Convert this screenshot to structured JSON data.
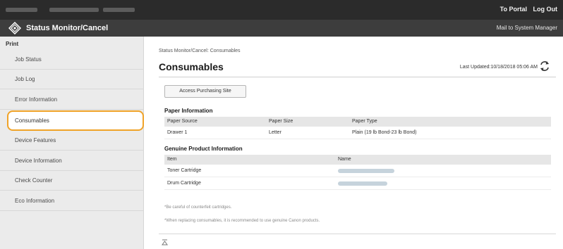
{
  "header": {
    "top_links": [
      "To Portal",
      "Log Out"
    ],
    "app_title": "Status Monitor/Cancel",
    "mail_link": "Mail to System Manager"
  },
  "sidebar": {
    "section": "Print",
    "items": [
      {
        "label": "Job Status"
      },
      {
        "label": "Job Log"
      },
      {
        "label": "Error Information"
      },
      {
        "label": "Consumables"
      },
      {
        "label": "Device Features"
      },
      {
        "label": "Device Information"
      },
      {
        "label": "Check Counter"
      },
      {
        "label": "Eco Information"
      }
    ],
    "active": "Consumables"
  },
  "main": {
    "breadcrumb": "Status Monitor/Cancel: Consumables",
    "title": "Consumables",
    "last_updated": "Last Updated:10/18/2018 05:06 AM",
    "access_button": "Access Purchasing Site",
    "paper": {
      "heading": "Paper Information",
      "columns": [
        "Paper Source",
        "Paper Size",
        "Paper Type"
      ],
      "rows": [
        [
          "Drawer 1",
          "Letter",
          "Plain (19 lb Bond-23 lb Bond)"
        ]
      ]
    },
    "genuine": {
      "heading": "Genuine Product Information",
      "columns": [
        "Item",
        "Name"
      ],
      "rows": [
        [
          "Toner Cartridge"
        ],
        [
          "Drum Cartridge"
        ]
      ]
    },
    "notes": [
      "*Be careful of counterfeit cartridges.",
      "*When replacing consumables, it is recommended to use genuine Canon products."
    ]
  },
  "colors": {
    "topbar": "#2b2b2b",
    "titlebar": "#3d3d3d",
    "sidebar": "#ebebeb",
    "active_highlight": "#f0a328"
  },
  "icons": {
    "logo": "canon-emblem-icon",
    "refresh": "refresh-icon",
    "back_to_top": "back-to-top-icon"
  }
}
